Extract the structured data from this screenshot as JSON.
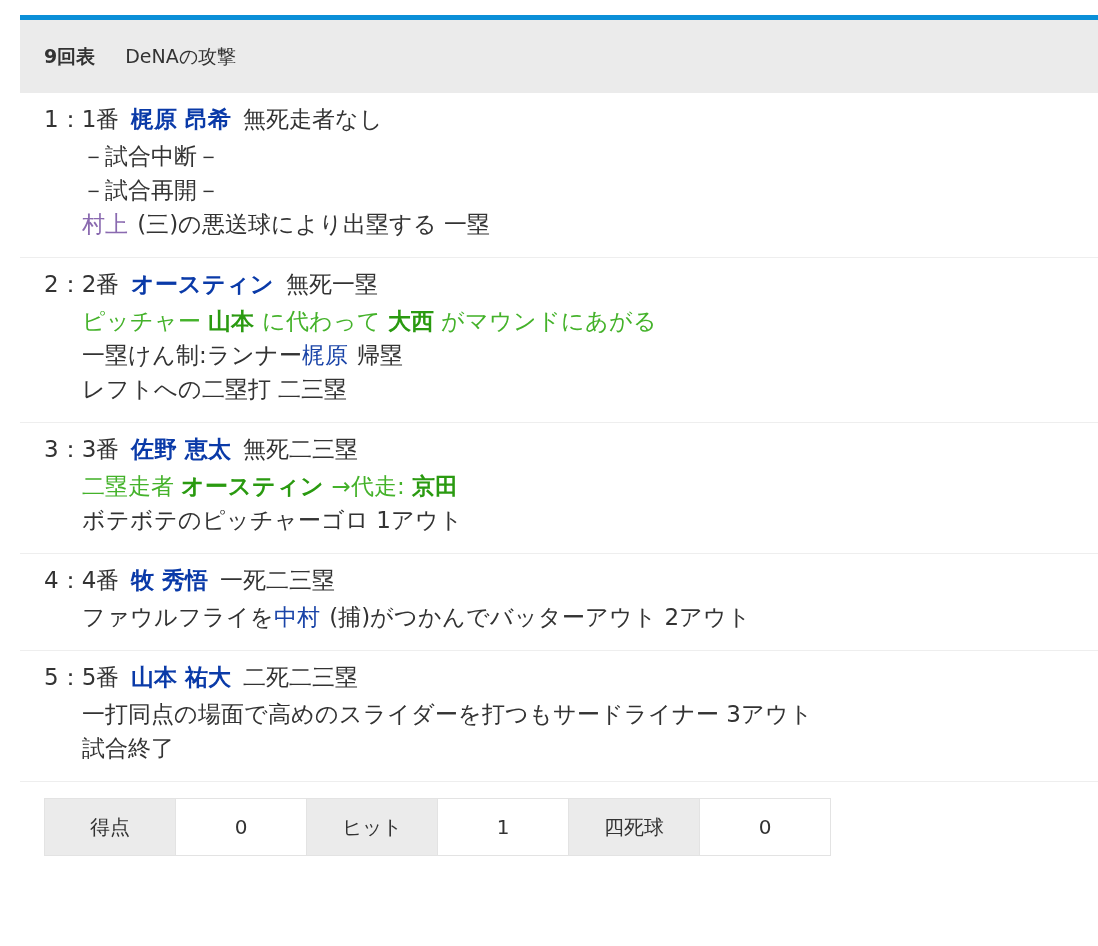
{
  "inning": {
    "label": "9回表",
    "title": "DeNAの攻撃"
  },
  "plays": [
    {
      "order": "1：1番",
      "batter": "梶原 昂希",
      "situation": "無死走者なし",
      "lines": [
        {
          "kind": "note",
          "parts": [
            {
              "text": "－試合中断－"
            }
          ]
        },
        {
          "kind": "note",
          "parts": [
            {
              "text": "－試合再開－"
            }
          ]
        },
        {
          "kind": "note",
          "parts": [
            {
              "text": "村上",
              "link": true,
              "visited": true
            },
            {
              "text": "(三)の悪送球により出塁する 一塁"
            }
          ]
        }
      ]
    },
    {
      "order": "2：2番",
      "batter": "オースティン",
      "situation": "無死一塁",
      "lines": [
        {
          "kind": "change",
          "parts": [
            {
              "text": "ピッチャー **山本** に代わって **大西** がマウンドにあがる"
            }
          ]
        },
        {
          "kind": "note",
          "parts": [
            {
              "text": "一塁けん制:ランナー"
            },
            {
              "text": "梶原",
              "link": true,
              "visited": false
            },
            {
              "text": "帰塁"
            }
          ]
        },
        {
          "kind": "note",
          "parts": [
            {
              "text": "レフトへの二塁打 二三塁"
            }
          ]
        }
      ]
    },
    {
      "order": "3：3番",
      "batter": "佐野 恵太",
      "situation": "無死二三塁",
      "lines": [
        {
          "kind": "change",
          "parts": [
            {
              "text": "二塁走者 **オースティン** →代走: **京田**"
            }
          ]
        },
        {
          "kind": "note",
          "parts": [
            {
              "text": "ボテボテのピッチャーゴロ 1アウト"
            }
          ]
        }
      ]
    },
    {
      "order": "4：4番",
      "batter": "牧 秀悟",
      "situation": "一死二三塁",
      "lines": [
        {
          "kind": "note",
          "parts": [
            {
              "text": "ファウルフライを"
            },
            {
              "text": "中村",
              "link": true,
              "visited": false
            },
            {
              "text": "(捕)がつかんでバッターアウト 2アウト"
            }
          ]
        }
      ]
    },
    {
      "order": "5：5番",
      "batter": "山本 祐大",
      "situation": "二死二三塁",
      "lines": [
        {
          "kind": "note",
          "parts": [
            {
              "text": "一打同点の場面で高めのスライダーを打つもサードライナー 3アウト"
            }
          ]
        },
        {
          "kind": "note",
          "parts": [
            {
              "text": "試合終了"
            }
          ]
        }
      ]
    }
  ],
  "summary": [
    {
      "label": "得点",
      "value": "0"
    },
    {
      "label": "ヒット",
      "value": "1"
    },
    {
      "label": "四死球",
      "value": "0"
    }
  ]
}
